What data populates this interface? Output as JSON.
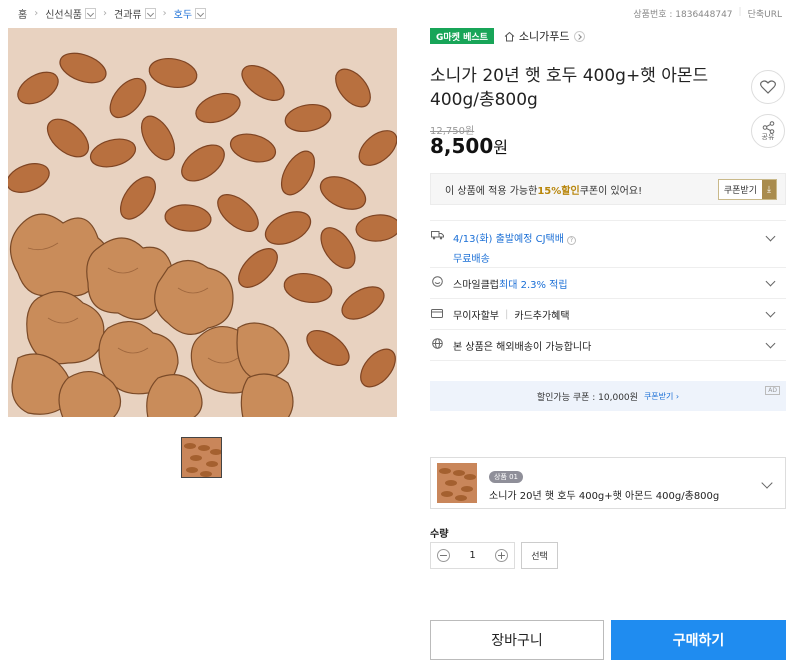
{
  "breadcrumb": {
    "home": "홈",
    "items": [
      "신선식품",
      "견과류",
      "호두"
    ]
  },
  "topright": {
    "product_no": "상품번호 : 1836448747",
    "short_url": "단축URL"
  },
  "badge": "G마켓 베스트",
  "seller": "소니가푸드",
  "title": "소니가 20년 햇 호두 400g+햇 아몬드 400g/총800g",
  "share_label": "공유",
  "price": {
    "original": "12,750원",
    "sale": "8,500",
    "unit": "원"
  },
  "coupon": {
    "text_pre": "이 상품에 적용 가능한 ",
    "highlight": "15%할인",
    "text_post": " 쿠폰이 있어요!",
    "button": "쿠폰받기"
  },
  "shipping": {
    "date": "4/13(화) 출발예정 CJ택배",
    "free": "무료배송"
  },
  "smileclub": {
    "label": "스마일클럽 ",
    "value": "최대 2.3% 적립"
  },
  "card": {
    "installment": "무이자할부",
    "benefit": "카드추가혜택"
  },
  "international": "본 상품은 해외배송이 가능합니다",
  "coupon_banner": {
    "text": "할인가능 쿠폰 : 10,000원",
    "link": "쿠폰받기 ›",
    "ad": "AD"
  },
  "option": {
    "tag": "상품 01",
    "name": "소니가 20년 햇 호두 400g+햇 아몬드 400g/총800g"
  },
  "quantity": {
    "label": "수량",
    "value": "1",
    "select": "선택"
  },
  "actions": {
    "cart": "장바구니",
    "buy": "구매하기"
  },
  "colors": {
    "accent": "#1f8cf0",
    "badge": "#18a558",
    "coupon_gold": "#a98c4e"
  }
}
